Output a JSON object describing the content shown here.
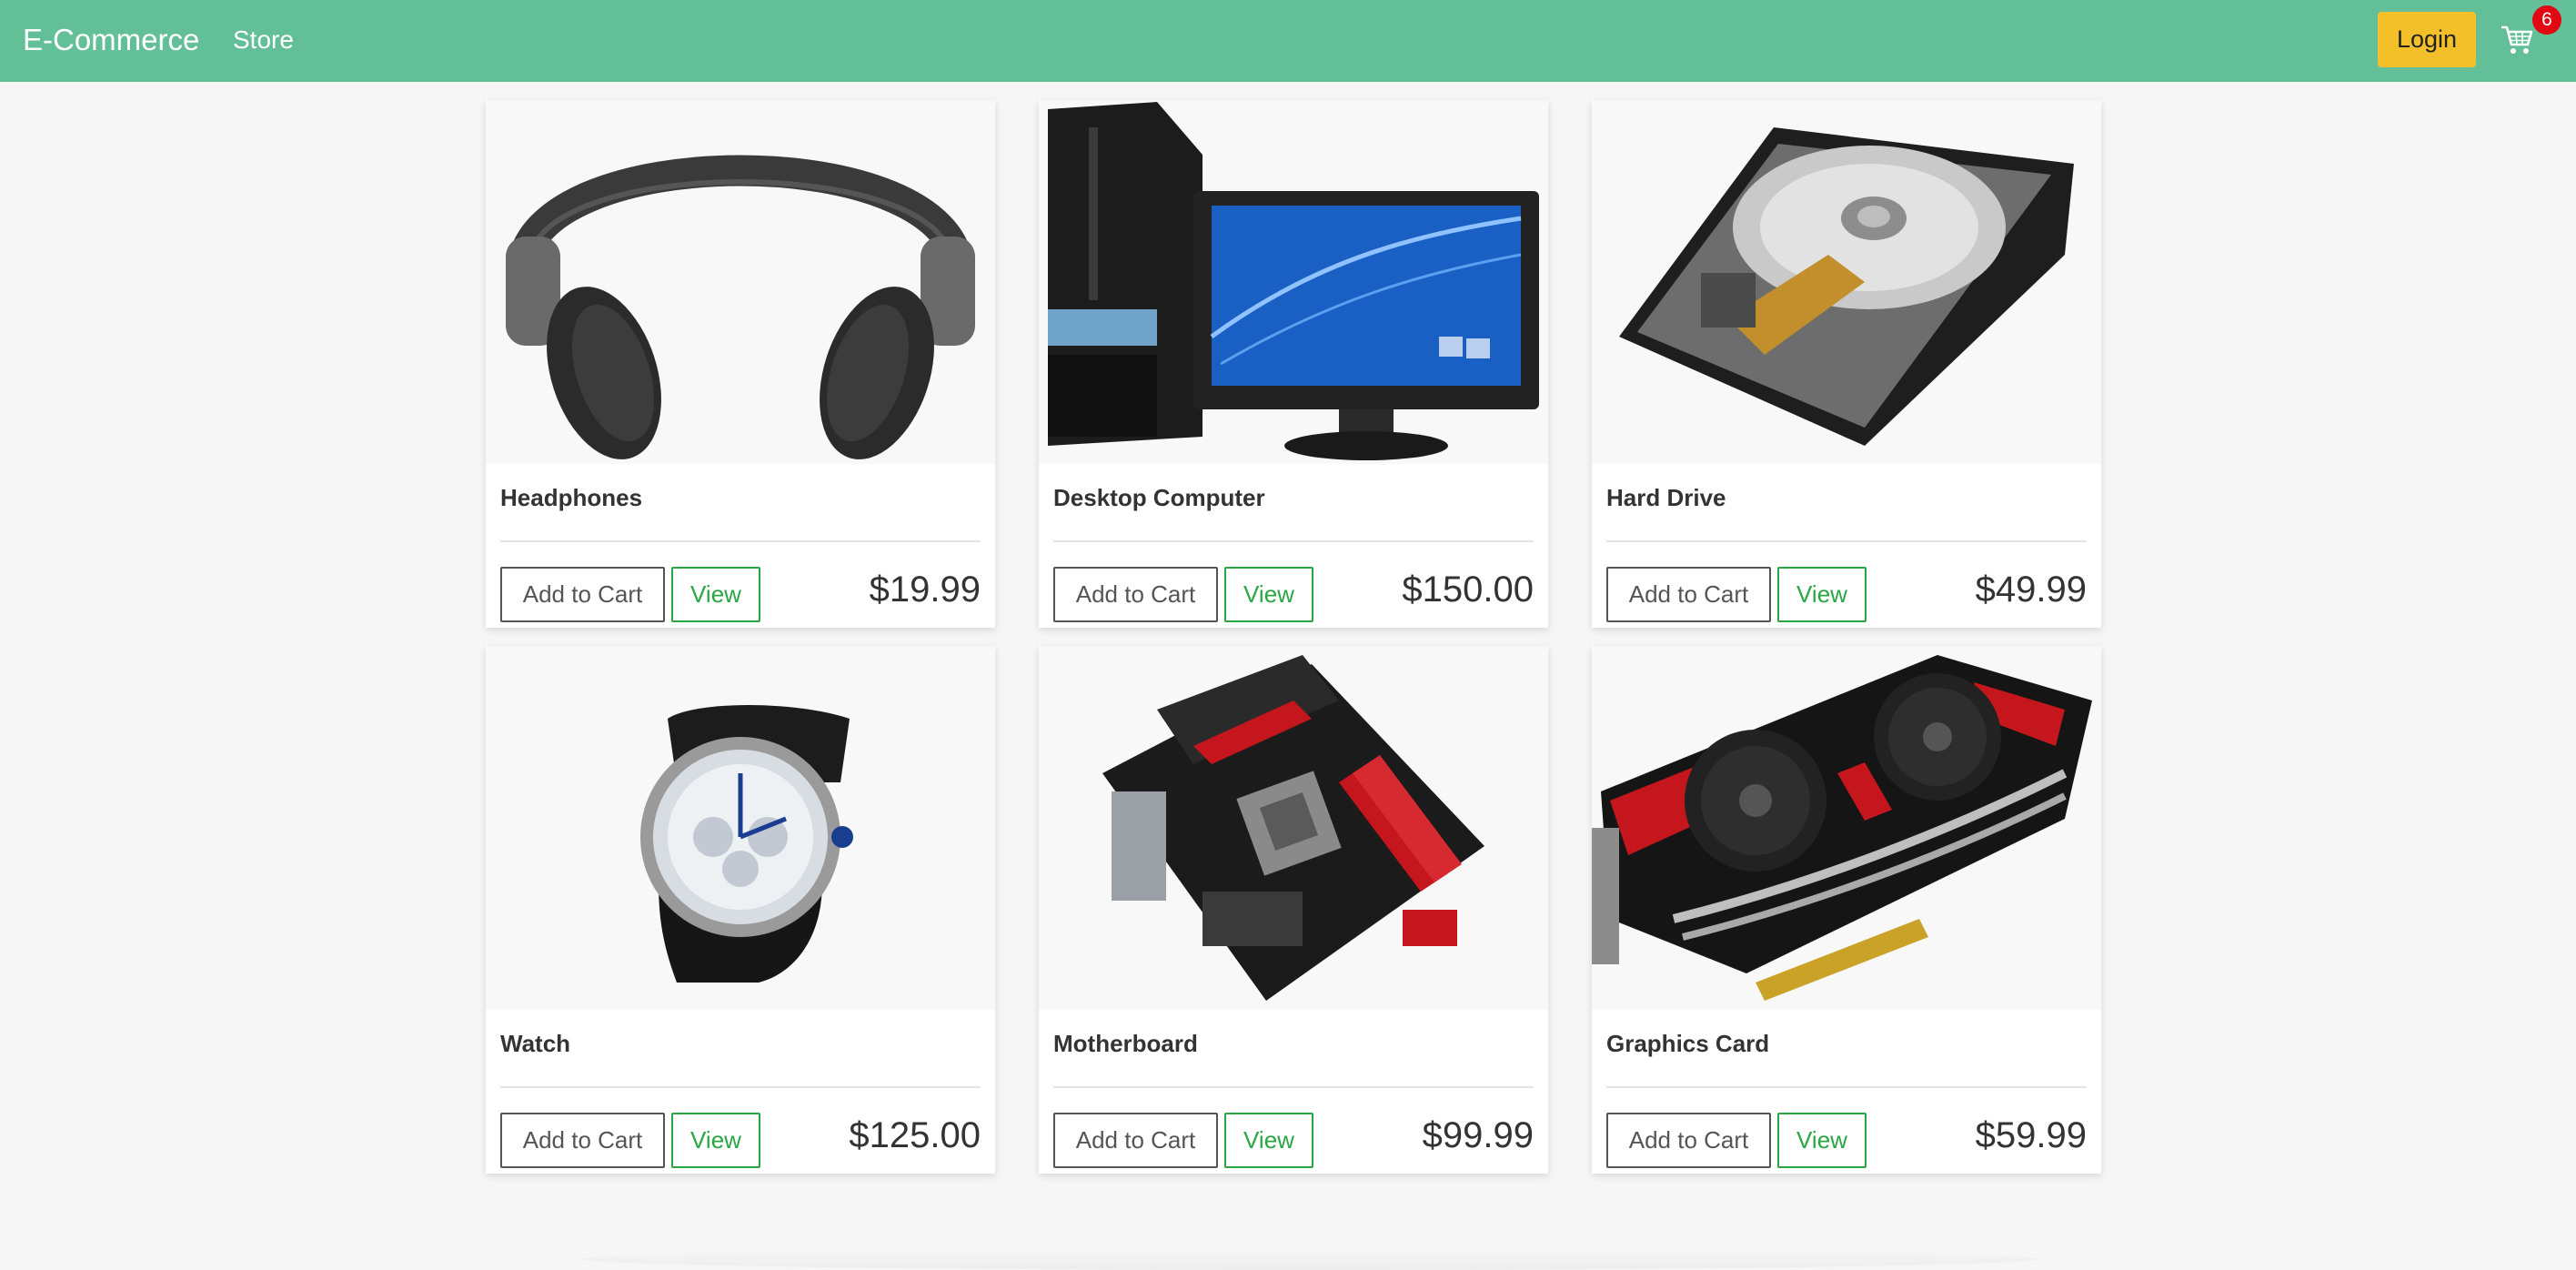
{
  "nav": {
    "brand": "E-Commerce",
    "store_link": "Store",
    "login_label": "Login",
    "cart_count": "6"
  },
  "products": [
    {
      "name": "Headphones",
      "price": "$19.99",
      "add_label": "Add to Cart",
      "view_label": "View"
    },
    {
      "name": "Desktop Computer",
      "price": "$150.00",
      "add_label": "Add to Cart",
      "view_label": "View"
    },
    {
      "name": "Hard Drive",
      "price": "$49.99",
      "add_label": "Add to Cart",
      "view_label": "View"
    },
    {
      "name": "Watch",
      "price": "$125.00",
      "add_label": "Add to Cart",
      "view_label": "View"
    },
    {
      "name": "Motherboard",
      "price": "$99.99",
      "add_label": "Add to Cart",
      "view_label": "View"
    },
    {
      "name": "Graphics Card",
      "price": "$59.99",
      "add_label": "Add to Cart",
      "view_label": "View"
    }
  ],
  "colors": {
    "navbar": "#63bf97",
    "login": "#f4c02a",
    "badge": "#e30613",
    "view_button": "#28a745"
  }
}
